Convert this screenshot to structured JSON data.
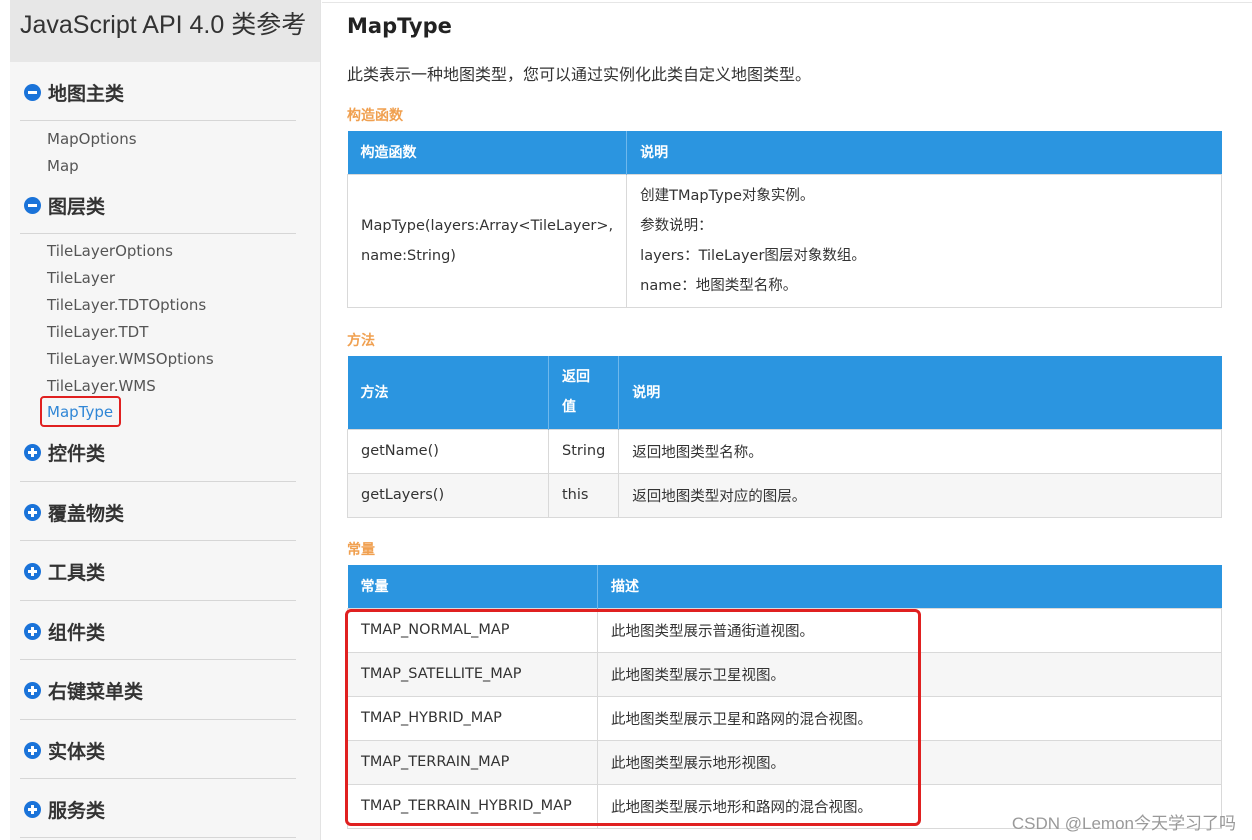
{
  "sidebar": {
    "title": "JavaScript API 4.0 类参考",
    "groups": [
      {
        "label": "地图主类",
        "expanded": true,
        "items": [
          "MapOptions",
          "Map"
        ]
      },
      {
        "label": "图层类",
        "expanded": true,
        "items": [
          "TileLayerOptions",
          "TileLayer",
          "TileLayer.TDTOptions",
          "TileLayer.TDT",
          "TileLayer.WMSOptions",
          "TileLayer.WMS",
          "MapType"
        ]
      },
      {
        "label": "控件类",
        "expanded": false
      },
      {
        "label": "覆盖物类",
        "expanded": false
      },
      {
        "label": "工具类",
        "expanded": false
      },
      {
        "label": "组件类",
        "expanded": false
      },
      {
        "label": "右键菜单类",
        "expanded": false
      },
      {
        "label": "实体类",
        "expanded": false
      },
      {
        "label": "服务类",
        "expanded": false
      }
    ],
    "active_item": "MapType"
  },
  "main": {
    "title": "MapType",
    "description": "此类表示一种地图类型，您可以通过实例化此类自定义地图类型。",
    "constructor_section": {
      "label": "构造函数",
      "headers": [
        "构造函数",
        "说明"
      ],
      "rows": [
        {
          "signature_line1": "MapType(layers:Array<TileLayer>,",
          "signature_line2": "name:String)",
          "desc": [
            "创建TMapType对象实例。",
            "参数说明：",
            "layers：TileLayer图层对象数组。",
            "name：地图类型名称。"
          ]
        }
      ]
    },
    "methods_section": {
      "label": "方法",
      "headers": [
        "方法",
        "返回值",
        "说明"
      ],
      "header_return_line1": "返回",
      "header_return_line2": "值",
      "rows": [
        {
          "method": "getName()",
          "returns": "String",
          "desc": "返回地图类型名称。"
        },
        {
          "method": "getLayers()",
          "returns": "this",
          "desc": "返回地图类型对应的图层。"
        }
      ]
    },
    "constants_section": {
      "label": "常量",
      "headers": [
        "常量",
        "描述"
      ],
      "rows": [
        {
          "name": "TMAP_NORMAL_MAP",
          "desc": "此地图类型展示普通街道视图。"
        },
        {
          "name": "TMAP_SATELLITE_MAP",
          "desc": "此地图类型展示卫星视图。"
        },
        {
          "name": "TMAP_HYBRID_MAP",
          "desc": "此地图类型展示卫星和路网的混合视图。"
        },
        {
          "name": "TMAP_TERRAIN_MAP",
          "desc": "此地图类型展示地形视图。"
        },
        {
          "name": "TMAP_TERRAIN_HYBRID_MAP",
          "desc": "此地图类型展示地形和路网的混合视图。"
        }
      ]
    }
  },
  "watermark": "CSDN @Lemon今天学习了吗",
  "colors": {
    "accent": "#2b95e0",
    "section_label": "#f0a050",
    "highlight_box": "#e02020",
    "active_link": "#2f86d6"
  }
}
